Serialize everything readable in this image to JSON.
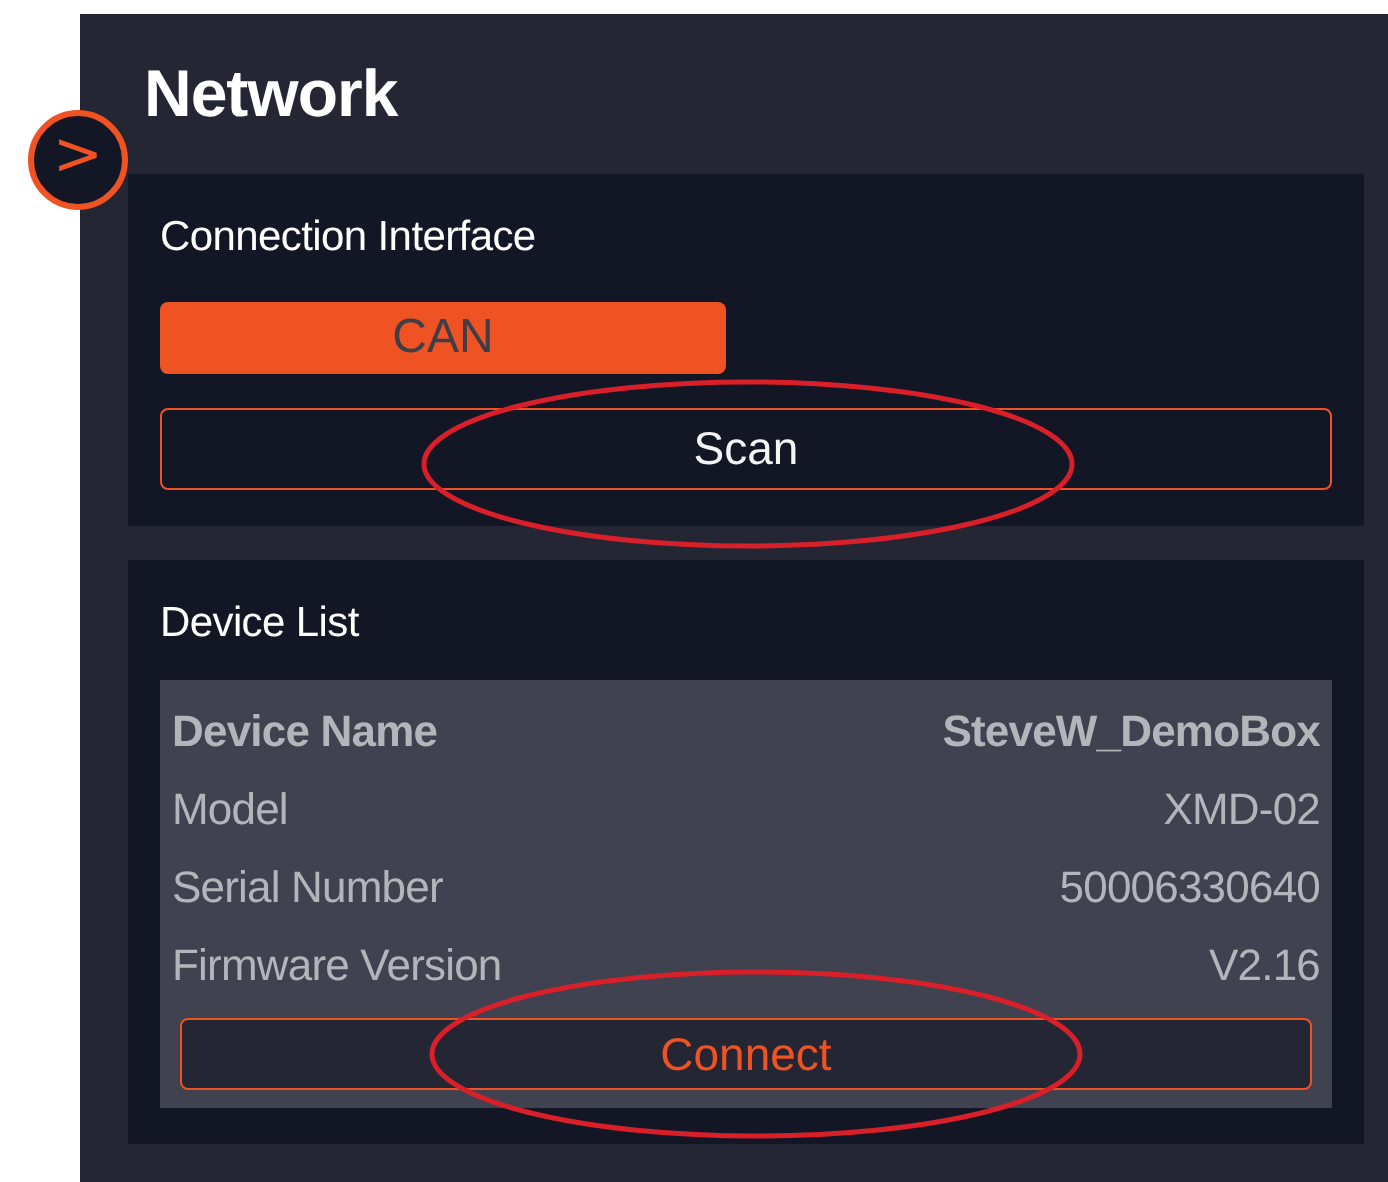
{
  "panel": {
    "title": "Network",
    "collapse_button": {
      "label": ">"
    }
  },
  "connection": {
    "heading": "Connection Interface",
    "interfaces": [
      {
        "label": "CAN",
        "selected": true
      }
    ],
    "scan_button": {
      "label": "Scan",
      "highlighted": true
    }
  },
  "device_list": {
    "heading": "Device List",
    "fields": [
      {
        "label": "Device Name",
        "value": "SteveW_DemoBox"
      },
      {
        "label": "Model",
        "value": "XMD-02"
      },
      {
        "label": "Serial Number",
        "value": "50006330640"
      },
      {
        "label": "Firmware Version",
        "value": "V2.16"
      }
    ],
    "connect_button": {
      "label": "Connect",
      "highlighted": true
    }
  }
}
